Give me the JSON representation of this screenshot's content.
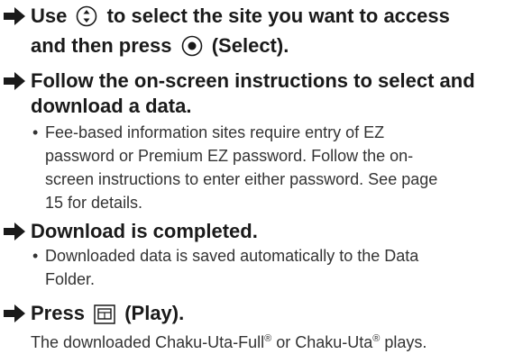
{
  "steps": [
    {
      "line1_before": "Use",
      "line1_icon": "navigation-updown-key-icon",
      "line1_after": "to select the site you want to access",
      "line2_before": "and then press",
      "line2_icon": "select-center-key-icon",
      "line2_after": "(Select)."
    },
    {
      "line1": "Follow the on-screen instructions to select and",
      "line2": "download a data.",
      "bullet_lines": [
        "Fee-based information sites require entry of EZ",
        "password or Premium EZ password. Follow the on-",
        "screen instructions to enter either password. See page",
        "15 for details."
      ]
    },
    {
      "line1": "Download is completed.",
      "bullet_lines": [
        "Downloaded data is saved automatically to the Data",
        "Folder."
      ]
    },
    {
      "line1_before": "Press",
      "line1_icon": "play-softkey-icon",
      "line1_after": "(Play).",
      "plain_before": "The downloaded Chaku-Uta-Full",
      "plain_reg1": "®",
      "plain_mid": " or Chaku-Uta",
      "plain_reg2": "®",
      "plain_after": " plays."
    }
  ],
  "bullet_char": "•",
  "colors": {
    "text": "#1a1a1a",
    "body_text": "#333333"
  }
}
